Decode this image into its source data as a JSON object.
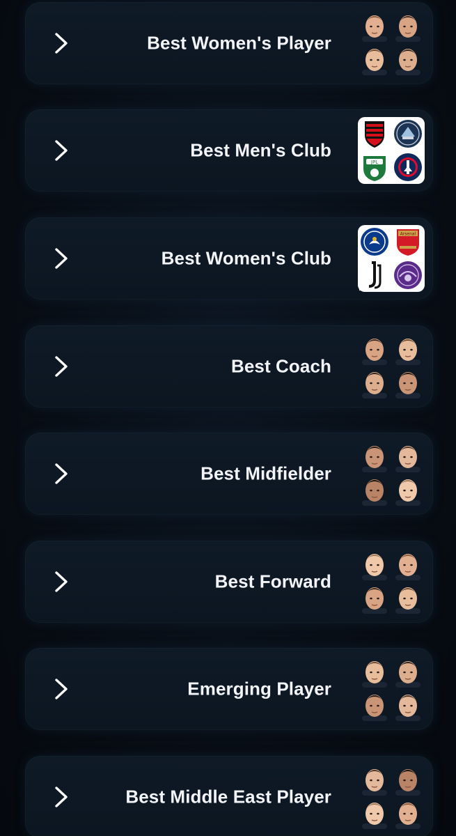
{
  "categories": [
    {
      "label": "Best Women's Player",
      "thumb_type": "portraits"
    },
    {
      "label": "Best Men's Club",
      "thumb_type": "club-crests"
    },
    {
      "label": "Best Women's Club",
      "thumb_type": "club-crests"
    },
    {
      "label": "Best Coach",
      "thumb_type": "portraits"
    },
    {
      "label": "Best Midfielder",
      "thumb_type": "portraits"
    },
    {
      "label": "Best Forward",
      "thumb_type": "portraits"
    },
    {
      "label": "Emerging Player",
      "thumb_type": "portraits"
    },
    {
      "label": "Best Middle East Player",
      "thumb_type": "portraits"
    }
  ],
  "crests": {
    "mens_club": [
      "flamengo-crest",
      "pachuca-crest",
      "al-ahli-crest",
      "psg-crest"
    ],
    "womens_club": [
      "chelsea-crest",
      "arsenal-crest",
      "juventus-crest",
      "orlando-pride-crest"
    ]
  },
  "colors": {
    "background": "#070c13",
    "card": "#0f1a27",
    "text": "#f2f4f7",
    "chevron": "#ffffff"
  }
}
